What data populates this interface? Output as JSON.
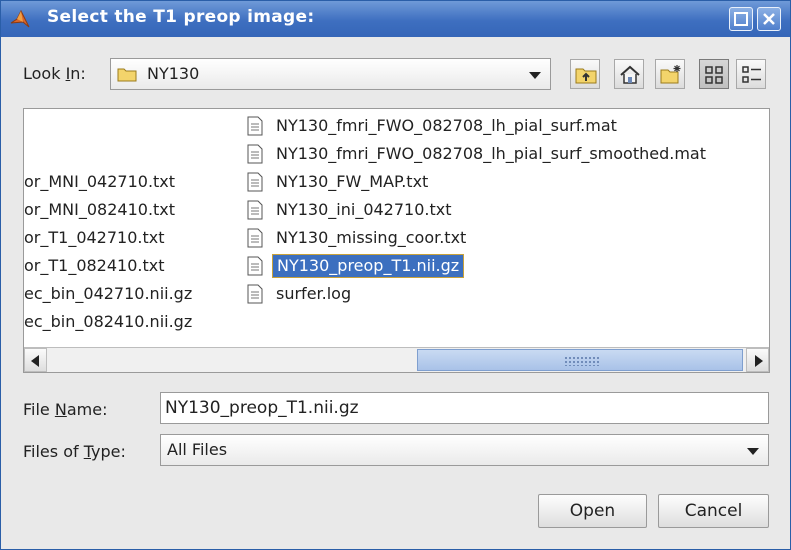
{
  "window": {
    "title": "Select the T1 preop image:",
    "minimize_icon": "maximize-icon",
    "close_icon": "close-icon"
  },
  "lookin": {
    "label_pre": "Look ",
    "label_mnemonic": "I",
    "label_post": "n:",
    "value": "NY130",
    "toolbar_icons": [
      "up-folder-icon",
      "home-icon",
      "new-folder-icon",
      "list-view-icon",
      "details-view-icon"
    ]
  },
  "files": {
    "left_column": [
      "or_MNI_042710.txt",
      "or_MNI_082410.txt",
      "or_T1_042710.txt",
      "or_T1_082410.txt",
      "ec_bin_042710.nii.gz",
      "ec_bin_082410.nii.gz"
    ],
    "right_column": [
      "NY130_fmri_FWO_082708_lh_pial_surf.mat",
      "NY130_fmri_FWO_082708_lh_pial_surf_smoothed.mat",
      "NY130_FW_MAP.txt",
      "NY130_ini_042710.txt",
      "NY130_missing_coor.txt",
      "NY130_preop_T1.nii.gz",
      "surfer.log"
    ],
    "selected": "NY130_preop_T1.nii.gz"
  },
  "filename": {
    "label_pre": "File ",
    "label_mnemonic": "N",
    "label_post": "ame:",
    "value": "NY130_preop_T1.nii.gz"
  },
  "filetype": {
    "label_pre": "Files of ",
    "label_mnemonic": "T",
    "label_post": "ype:",
    "value": "All Files"
  },
  "buttons": {
    "open": "Open",
    "cancel": "Cancel"
  },
  "colors": {
    "titlebar": "#3e6fc0",
    "selection": "#3c6fbf",
    "folder": "#f3d46b"
  }
}
